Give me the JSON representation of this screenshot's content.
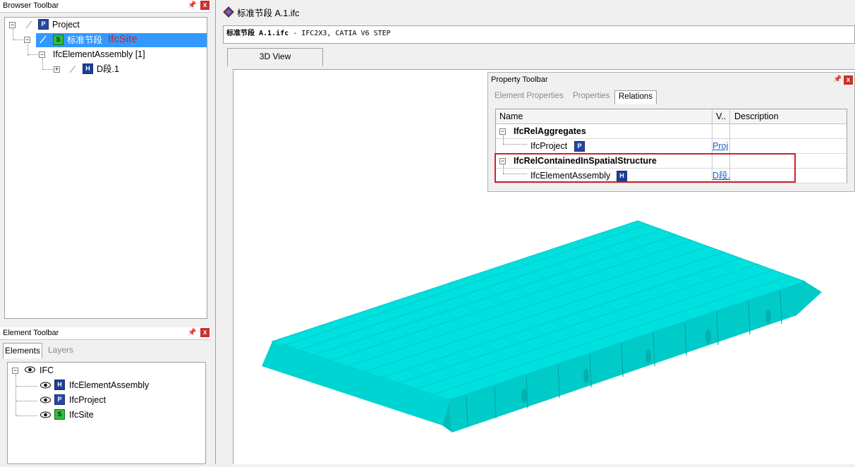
{
  "browser_toolbar": {
    "title": "Browser Toolbar",
    "pin": "ⴽ",
    "close": "x",
    "tree": {
      "project": "Project",
      "site": "标准节段",
      "site_annotation": "IfcSite",
      "assembly": "IfcElementAssembly [1]",
      "d_segment": "D段.1"
    }
  },
  "element_toolbar": {
    "title": "Element Toolbar",
    "tabs": [
      "Elements",
      "Layers"
    ],
    "tree": {
      "root": "IFC",
      "items": [
        "IfcElementAssembly",
        "IfcProject",
        "IfcSite"
      ]
    }
  },
  "document": {
    "title": "标准节段 A.1.ifc",
    "info_bold": "标准节段 A.1.ifc",
    "info_rest": " - IFC2X3, CATIA V6 STEP",
    "view_tab": "3D View"
  },
  "property_toolbar": {
    "title": "Property Toolbar",
    "tabs": [
      "Element Properties",
      "Properties",
      "Relations"
    ],
    "active_tab": "Relations",
    "columns": [
      "Name",
      "V..",
      "Description"
    ],
    "rows": [
      {
        "name": "IfcRelAggregates",
        "value": "",
        "bold": true
      },
      {
        "name": "IfcProject",
        "value": "Proj",
        "bold": false
      },
      {
        "name": "IfcRelContainedInSpatialStructure",
        "value": "",
        "bold": true
      },
      {
        "name": "IfcElementAssembly",
        "value": "D段.",
        "bold": false
      }
    ]
  },
  "colors": {
    "model": "#00e5e0",
    "highlight": "#d0202a",
    "selection": "#3399ff"
  }
}
